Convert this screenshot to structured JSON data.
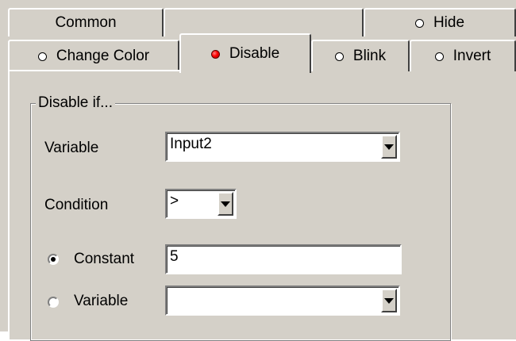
{
  "tabs_row_back": [
    {
      "label": "Common"
    },
    {
      "label": ""
    },
    {
      "label": "Hide"
    }
  ],
  "tabs_row_front": [
    {
      "label": "Change Color"
    },
    {
      "label": "Disable"
    },
    {
      "label": "Blink"
    },
    {
      "label": "Invert"
    }
  ],
  "group": {
    "title": "Disable if...",
    "variable_label": "Variable",
    "variable_value": "Input2",
    "condition_label": "Condition",
    "condition_value": ">",
    "constant_label": "Constant",
    "constant_value": "5",
    "variable2_label": "Variable",
    "variable2_value": ""
  },
  "colors": {
    "face": "#d4d0c8",
    "active_indicator": "#ff0000"
  }
}
